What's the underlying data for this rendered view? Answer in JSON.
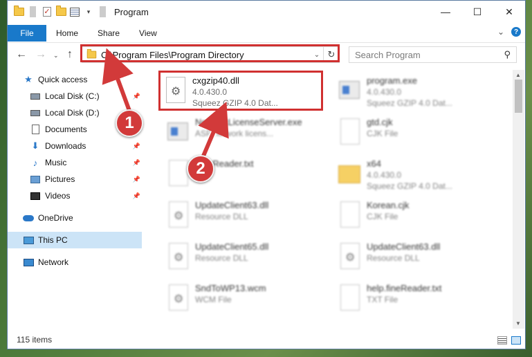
{
  "window": {
    "title": "Program"
  },
  "ribbon": {
    "file": "File",
    "tabs": [
      "Home",
      "Share",
      "View"
    ],
    "help": "?"
  },
  "address": {
    "path": "C:\\Program Files\\Program Directory"
  },
  "search": {
    "placeholder": "Search Program"
  },
  "sidebar": {
    "items": [
      {
        "label": "Quick access",
        "icon": "star-icon",
        "pinned": false
      },
      {
        "label": "Local Disk (C:)",
        "icon": "disk-icon",
        "pinned": true
      },
      {
        "label": "Local Disk (D:)",
        "icon": "disk-icon",
        "pinned": false
      },
      {
        "label": "Documents",
        "icon": "document-icon",
        "pinned": false
      },
      {
        "label": "Downloads",
        "icon": "download-icon",
        "pinned": true
      },
      {
        "label": "Music",
        "icon": "music-icon",
        "pinned": true
      },
      {
        "label": "Pictures",
        "icon": "pictures-icon",
        "pinned": true
      },
      {
        "label": "Videos",
        "icon": "videos-icon",
        "pinned": true
      },
      {
        "label": "OneDrive",
        "icon": "cloud-icon",
        "pinned": false
      },
      {
        "label": "This PC",
        "icon": "computer-icon",
        "pinned": false,
        "selected": true
      },
      {
        "label": "Network",
        "icon": "network-icon",
        "pinned": false
      }
    ]
  },
  "files": [
    {
      "name": "cxgzip40.dll",
      "line2": "4.0.430.0",
      "line3": "Squeez GZIP 4.0 Dat...",
      "icon": "dll-gear-icon",
      "highlighted": true
    },
    {
      "name": "program.exe",
      "line2": "4.0.430.0",
      "line3": "Squeez GZIP 4.0 Dat...",
      "icon": "exe-icon"
    },
    {
      "name": "NetworkLicenseServer.exe",
      "line2": "ASP network licens...",
      "line3": "",
      "icon": "exe-icon"
    },
    {
      "name": "gtd.cjk",
      "line2": "CJK File",
      "line3": "",
      "icon": "file-icon"
    },
    {
      "name": "FineReader.txt",
      "line2": "",
      "line3": "",
      "icon": "file-icon"
    },
    {
      "name": "x64",
      "line2": "4.0.430.0",
      "line3": "Squeez GZIP 4.0 Dat...",
      "icon": "folder-icon"
    },
    {
      "name": "UpdateClient63.dll",
      "line2": "Resource DLL",
      "line3": "",
      "icon": "dll-gear-icon"
    },
    {
      "name": "Korean.cjk",
      "line2": "CJK File",
      "line3": "",
      "icon": "file-icon"
    },
    {
      "name": "UpdateClient65.dll",
      "line2": "Resource DLL",
      "line3": "",
      "icon": "dll-gear-icon"
    },
    {
      "name": "UpdateClient63.dll",
      "line2": "Resource DLL",
      "line3": "",
      "icon": "dll-gear-icon"
    },
    {
      "name": "SndToWP13.wcm",
      "line2": "WCM File",
      "line3": "",
      "icon": "dll-gear-icon"
    },
    {
      "name": "help.fineReader.txt",
      "line2": "TXT File",
      "line3": "",
      "icon": "file-icon"
    }
  ],
  "status": {
    "count": "115 items"
  },
  "callouts": [
    "1",
    "2"
  ],
  "colors": {
    "accent": "#1979ca",
    "highlight": "#d03030",
    "callout": "#d23a3a"
  }
}
